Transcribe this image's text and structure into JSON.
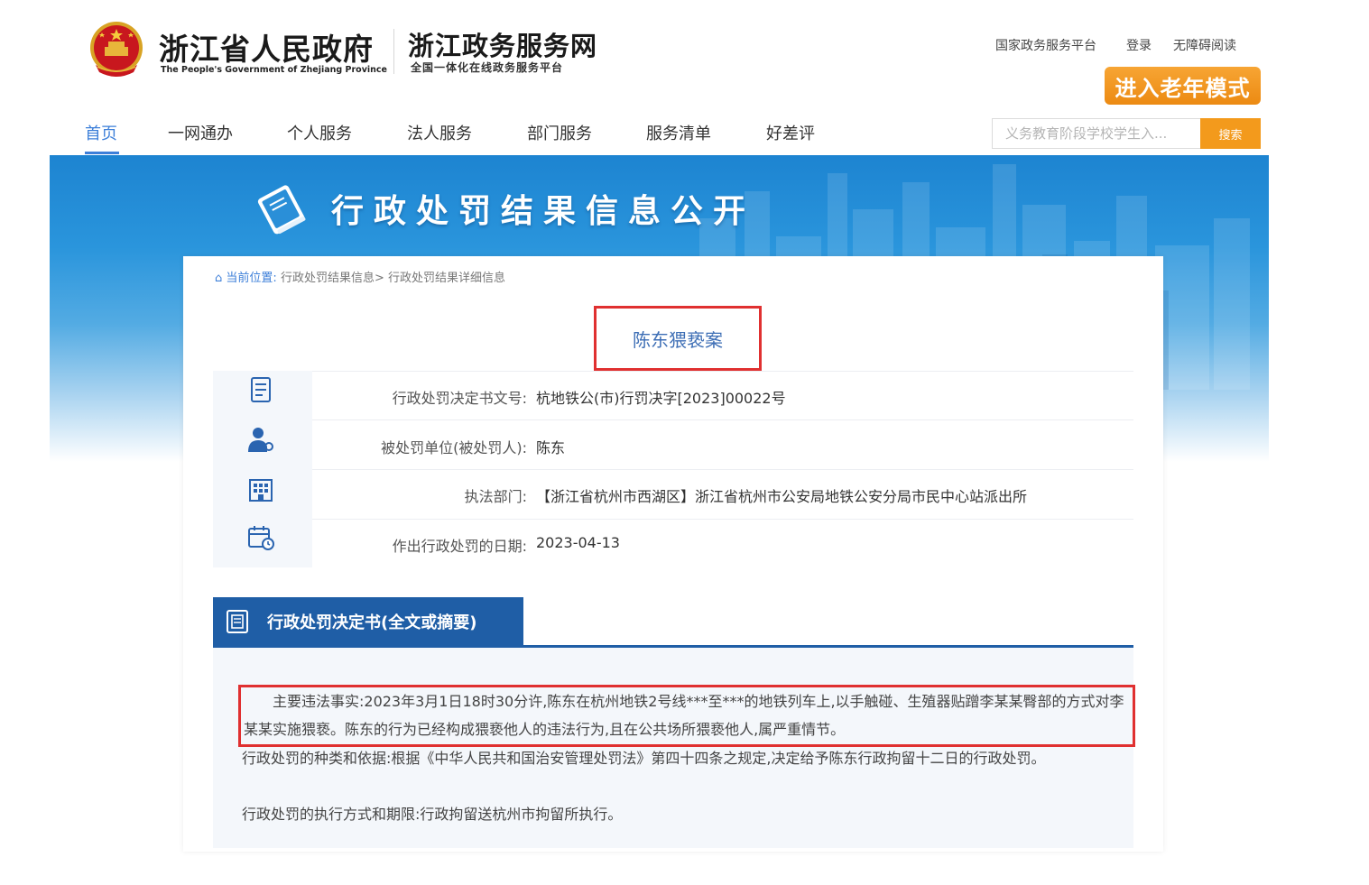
{
  "header": {
    "gov_title": "浙江省人民政府",
    "gov_subtitle": "The People's Government of Zhejiang Province",
    "service_title": "浙江政务服务网",
    "service_subtitle": "全国一体化在线政务服务平台",
    "top_links": [
      "国家政务服务平台",
      "登录",
      "无障碍阅读"
    ],
    "elder_mode_button": "进入老年模式",
    "colors": {
      "accent_orange": "#f39a1c",
      "link_blue": "#3d7fd9"
    }
  },
  "nav": {
    "items": [
      "首页",
      "一网通办",
      "个人服务",
      "法人服务",
      "部门服务",
      "服务清单",
      "好差评"
    ],
    "active_index": 0
  },
  "search": {
    "placeholder": "义务教育阶段学校学生入...",
    "button_label": "搜索"
  },
  "banner": {
    "title": "行政处罚结果信息公开"
  },
  "breadcrumb": {
    "current_label": "当前位置:",
    "path": "行政处罚结果信息> 行政处罚结果详细信息"
  },
  "case": {
    "title": "陈东猥亵案",
    "fields": [
      {
        "icon": "document-icon",
        "label": "行政处罚决定书文号:",
        "value": "杭地铁公(市)行罚决字[2023]00022号"
      },
      {
        "icon": "person-icon",
        "label": "被处罚单位(被处罚人):",
        "value": "陈东"
      },
      {
        "icon": "building-icon",
        "label": "执法部门:",
        "value": "【浙江省杭州市西湖区】浙江省杭州市公安局地铁公安分局市民中心站派出所"
      },
      {
        "icon": "calendar-icon",
        "label": "作出行政处罚的日期:",
        "value": "2023-04-13"
      }
    ]
  },
  "decision": {
    "section_title": "行政处罚决定书(全文或摘要)",
    "facts": "主要违法事实:2023年3月1日18时30分许,陈东在杭州地铁2号线***至***的地铁列车上,以手触碰、生殖器贴蹭李某某臀部的方式对李某某实施猥亵。陈东的行为已经构成猥亵他人的违法行为,且在公共场所猥亵他人,属严重情节。",
    "basis": "行政处罚的种类和依据:根据《中华人民共和国治安管理处罚法》第四十四条之规定,决定给予陈东行政拘留十二日的行政处罚。",
    "execution": "行政处罚的执行方式和期限:行政拘留送杭州市拘留所执行。"
  }
}
